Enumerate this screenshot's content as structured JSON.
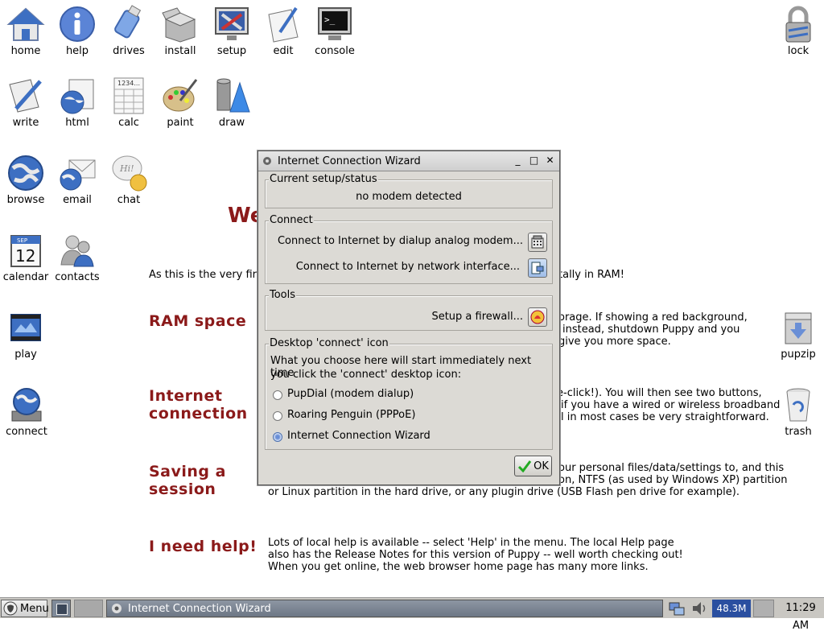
{
  "desktop": {
    "icons": {
      "home": "home",
      "help": "help",
      "drives": "drives",
      "install": "install",
      "setup": "setup",
      "edit": "edit",
      "console": "console",
      "lock": "lock",
      "write": "write",
      "html": "html",
      "calc": "calc",
      "paint": "paint",
      "draw": "draw",
      "browse": "browse",
      "email": "email",
      "chat": "chat",
      "calendar": "calendar",
      "contacts": "contacts",
      "play": "play",
      "connect": "connect",
      "pupzip": "pupzip",
      "trash": "trash"
    },
    "calendar_month": "SEP",
    "calendar_day": "12",
    "calc_digits": "1234..."
  },
  "welcome": {
    "title_fragment": "We",
    "intro": "As this is the very firs",
    "intro_tail": "tally in RAM!",
    "sections": [
      {
        "heading": "RAM space",
        "lines": [
          "orage. If showing a red background,",
          "instead, shutdown Puppy and you",
          "give you more space."
        ]
      },
      {
        "heading_line1": "Internet",
        "heading_line2": "connection",
        "lines": [
          "e-click!). You will then see two buttons,",
          "if you have a wired or wireless broadband",
          "l in most cases be very straightforward."
        ]
      },
      {
        "heading_line1": "Saving a",
        "heading_line2": "session",
        "lines": [
          "our personal files/data/settings to, and this",
          "on, NTFS (as used by Windows XP) partition",
          "or Linux partition in the hard drive, or any plugin drive (USB Flash pen drive for example)."
        ]
      },
      {
        "heading": "I need help!",
        "lines": [
          "Lots of local help is available -- select 'Help' in the menu. The local Help page",
          "also has the Release Notes for this version of Puppy -- well worth checking out!",
          "When you get online, the web browser home page has many more links."
        ]
      }
    ]
  },
  "dialog": {
    "title": "Internet Connection Wizard",
    "status_frame": {
      "label": "Current setup/status",
      "value": "no modem detected"
    },
    "connect_frame": {
      "label": "Connect",
      "dialup": "Connect to Internet by dialup analog modem...",
      "network": "Connect to Internet by network interface..."
    },
    "tools_frame": {
      "label": "Tools",
      "firewall": "Setup a firewall..."
    },
    "icon_frame": {
      "label": "Desktop 'connect' icon",
      "desc_line1": "What you choose here will start immediately next time",
      "desc_line2": "you click the 'connect' desktop icon:",
      "options": [
        "PupDial (modem dialup)",
        "Roaring Penguin (PPPoE)",
        "Internet Connection Wizard"
      ],
      "selected": "Internet Connection Wizard"
    },
    "ok_label": "OK"
  },
  "taskbar": {
    "menu_label": "Menu",
    "task_title": "Internet Connection Wizard",
    "memory": "48.3M",
    "clock": "11:29 AM"
  },
  "colors": {
    "heading_red": "#8b1a1a",
    "memory_bg": "#2a4fa0",
    "dialog_bg": "#dcdad5"
  }
}
